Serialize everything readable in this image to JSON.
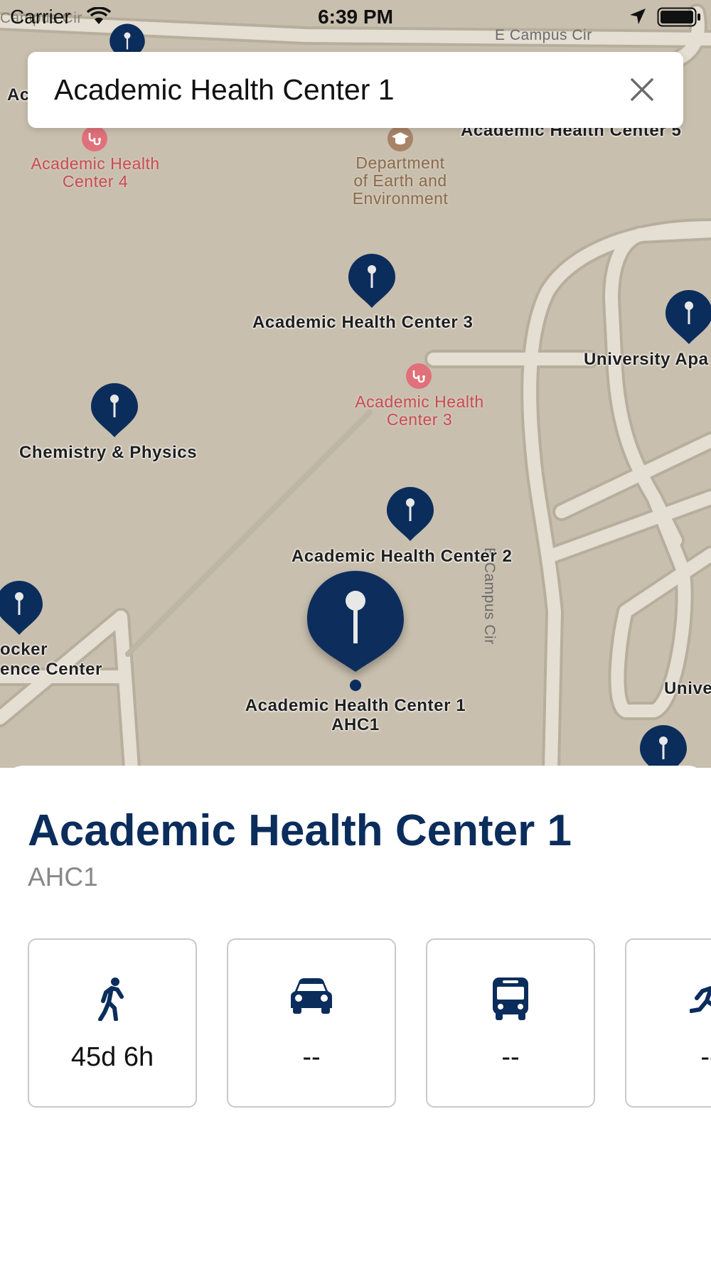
{
  "status_bar": {
    "carrier": "Carrier",
    "time": "6:39 PM",
    "wifi_icon": "wifi-icon",
    "location_icon": "location-arrow-icon",
    "battery_icon": "battery-icon"
  },
  "search": {
    "query": "Academic Health Center 1",
    "clear_icon": "close-icon"
  },
  "map": {
    "pin_color": "#0b2d5c",
    "poi_health_color": "#c94a55",
    "poi_education_color": "#8a6a4f",
    "background_color": "#c9bfae",
    "road_color": "#e4ded3",
    "road_labels": {
      "top": "E Campus Cir",
      "right": "E Campus Cir",
      "top_left_fragment": "Campus Cir"
    },
    "pins": {
      "ahc3": "Academic Health Center 3",
      "univ_apts": "University Apa",
      "chem_phys": "Chemistry & Physics",
      "ahc2": "Academic Health Center 2",
      "crocker_line1": "ocker",
      "crocker_line2": "ence Center",
      "ahc1": "Academic Health Center 1",
      "ahc1_code": "AHC1",
      "univ_bottom": "Unive",
      "ahc5": "Academic Health Center 5",
      "top_left_fragment": "Ac"
    },
    "pois": {
      "ahc4_line1": "Academic Health",
      "ahc4_line2": "Center 4",
      "earth_line1": "Department",
      "earth_line2": "of Earth and",
      "earth_line3": "Environment",
      "ahc3_line1": "Academic Health",
      "ahc3_line2": "Center 3"
    }
  },
  "sheet": {
    "title": "Academic Health Center 1",
    "subtitle": "AHC1",
    "modes": [
      {
        "icon": "walking-icon",
        "value": "45d 6h"
      },
      {
        "icon": "car-icon",
        "value": "--"
      },
      {
        "icon": "bus-icon",
        "value": "--"
      },
      {
        "icon": "running-icon",
        "value": "--"
      }
    ]
  }
}
